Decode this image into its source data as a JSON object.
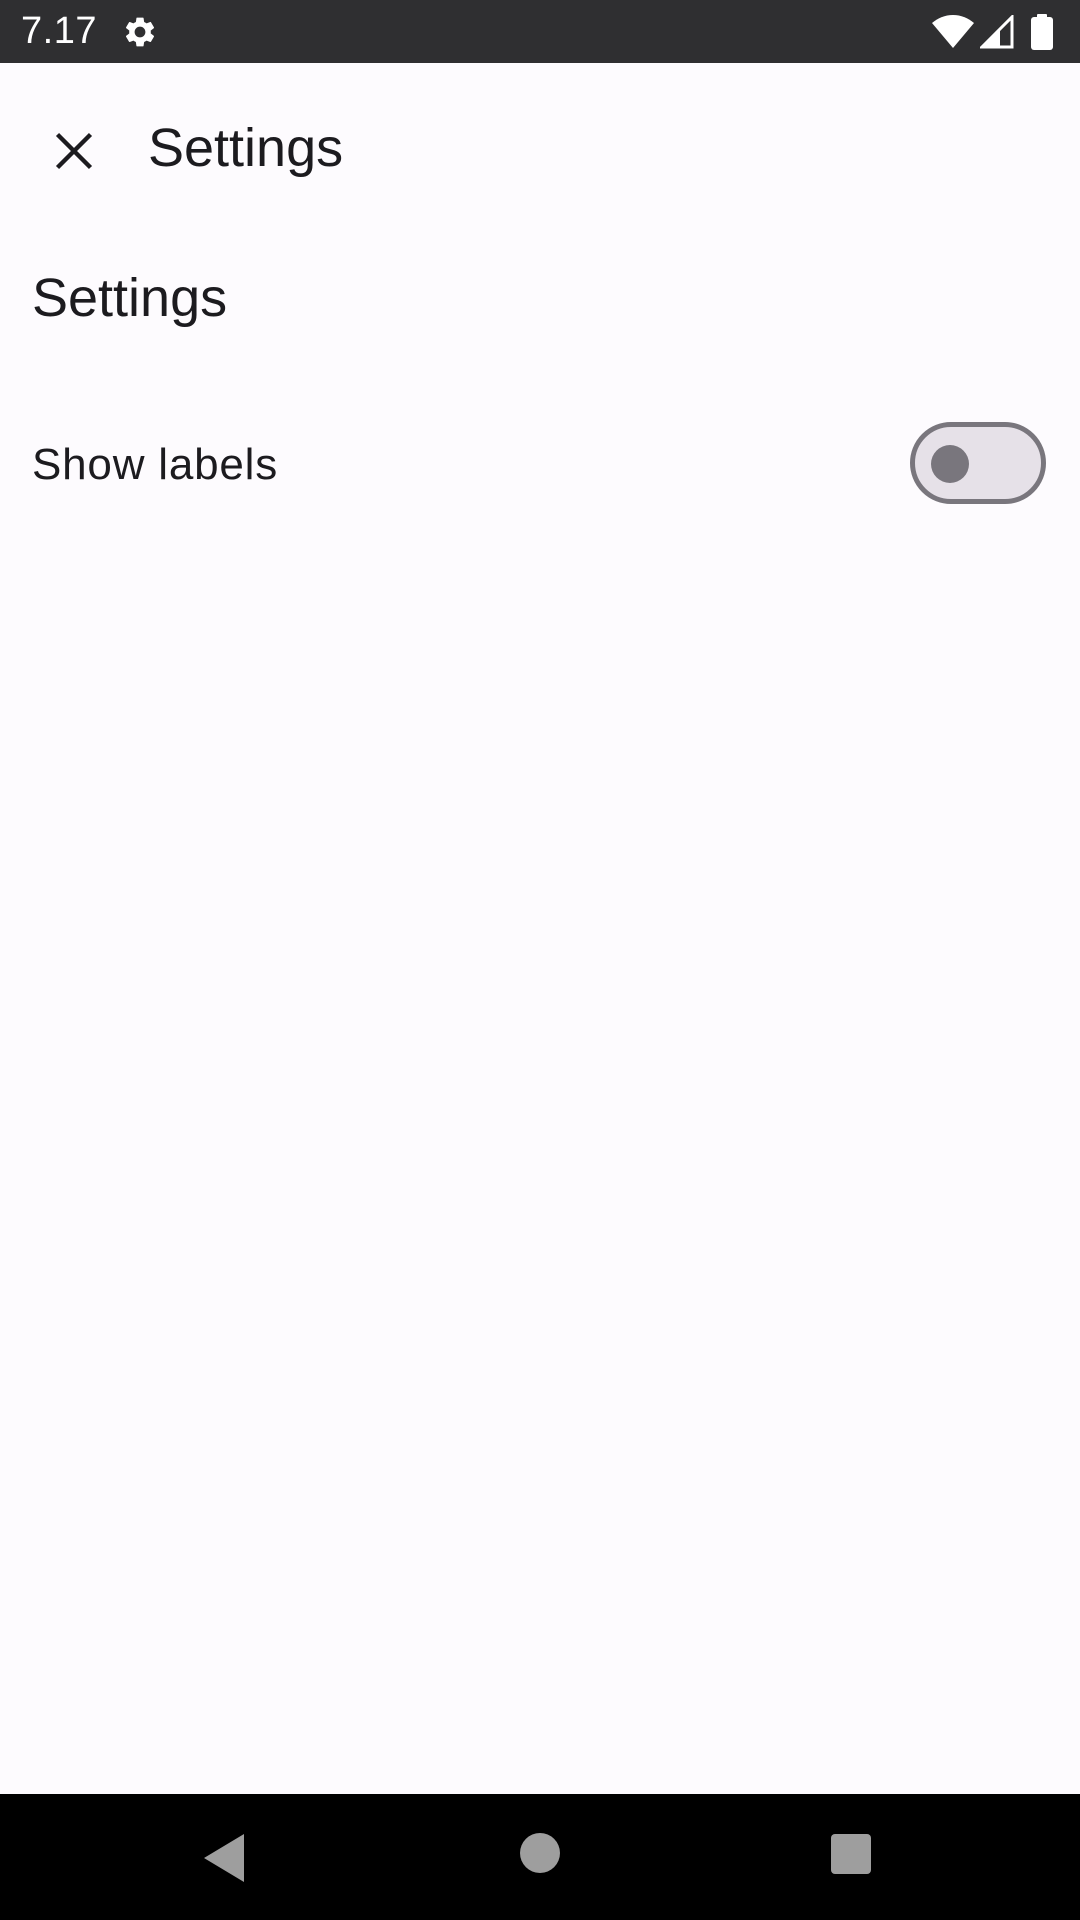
{
  "status_bar": {
    "time": "7.17",
    "icons": [
      "gear-icon",
      "wifi-icon",
      "signal-icon",
      "battery-icon"
    ]
  },
  "app_bar": {
    "title": "Settings",
    "close_icon": "close-icon"
  },
  "section": {
    "title": "Settings"
  },
  "preferences": [
    {
      "label": "Show labels",
      "type": "switch",
      "checked": false
    }
  ],
  "nav_bar": {
    "icons": [
      "back-icon",
      "home-icon",
      "recents-icon"
    ]
  },
  "colors": {
    "background": "#fdfbfe",
    "status_bar": "#2f2f31",
    "text": "#1c1b1f",
    "switch_outline": "#79767d",
    "switch_track": "#e6e1e8",
    "nav_bar": "#000000"
  }
}
